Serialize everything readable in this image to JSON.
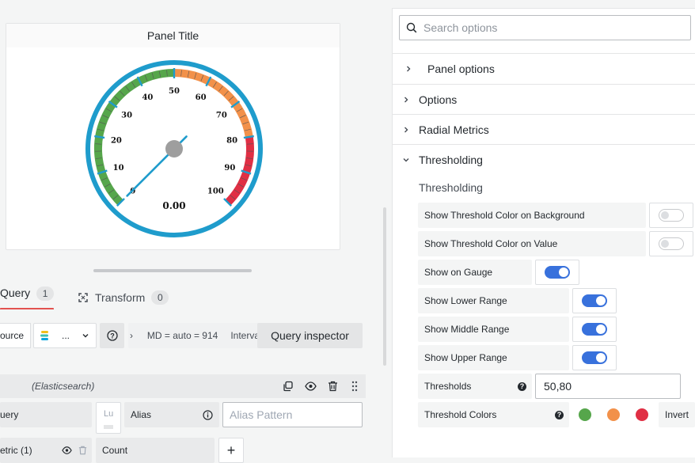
{
  "panel": {
    "title": "Panel Title",
    "gauge_value": "0.00",
    "value_num": 0,
    "thresholds": [
      50,
      80
    ],
    "range": [
      0,
      100
    ],
    "tick_labels": [
      "0",
      "10",
      "20",
      "30",
      "40",
      "50",
      "60",
      "70",
      "80",
      "90",
      "100"
    ]
  },
  "tabs": {
    "query_label": "Query",
    "query_count": "1",
    "transform_label": "Transform",
    "transform_count": "0"
  },
  "query_toolbar": {
    "source_label": "ource",
    "datasource_abbrev": "...",
    "info_text": "MD = auto = 914",
    "interval_ghost": "Interva",
    "query_inspector_label": "Query inspector"
  },
  "query_row": {
    "datasource_name": "(Elasticsearch)",
    "query_label": "uery",
    "lucene_placeholder": "Lu",
    "alias_label": "Alias",
    "alias_placeholder": "Alias Pattern",
    "metric_label": "etric (1)",
    "count_label": "Count",
    "add_label": "+"
  },
  "options": {
    "search_placeholder": "Search options",
    "sections": [
      "Panel options",
      "Options",
      "Radial Metrics",
      "Thresholding"
    ],
    "subsection_title": "Thresholding",
    "rows": [
      {
        "label": "Show Threshold Color on Background",
        "on": false
      },
      {
        "label": "Show Threshold Color on Value",
        "on": false
      },
      {
        "label": "Show on Gauge",
        "on": true
      },
      {
        "label": "Show Lower Range",
        "on": true
      },
      {
        "label": "Show Middle Range",
        "on": true
      },
      {
        "label": "Show Upper Range",
        "on": true
      }
    ],
    "thresholds_label": "Thresholds",
    "thresholds_value": "50,80",
    "threshold_colors_label": "Threshold Colors",
    "threshold_colors": [
      "#56a64b",
      "#f2914a",
      "#e02f44"
    ],
    "invert_label": "Invert"
  },
  "colors": {
    "gauge_ring": "#1f9ccc",
    "needle": "#1f9ccc",
    "hub": "#9e9e9e",
    "green": "#56a64b",
    "orange": "#f2914a",
    "red": "#e02f44",
    "toggle_on": "#3871dc",
    "active_tab": "#e2524f"
  }
}
